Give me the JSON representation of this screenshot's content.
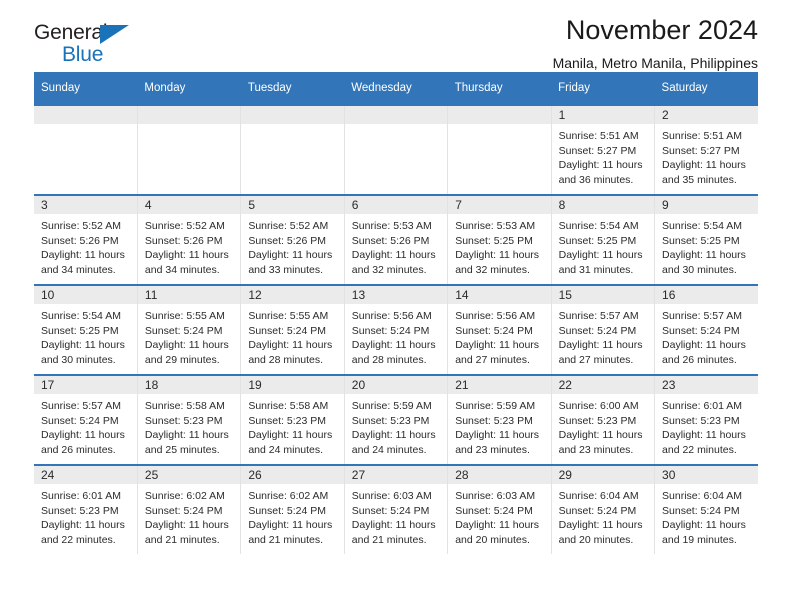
{
  "brand": {
    "name_top": "General",
    "name_bottom": "Blue",
    "triangle_icon": "brand-triangle-icon",
    "accent_color": "#1a72b8"
  },
  "header": {
    "title": "November 2024",
    "subtitle": "Manila, Metro Manila, Philippines"
  },
  "theme": {
    "header_blue": "#3275b8",
    "daynum_band": "#ebebeb",
    "text": "#2b2b2b"
  },
  "calendar": {
    "weekday_headers": [
      "Sunday",
      "Monday",
      "Tuesday",
      "Wednesday",
      "Thursday",
      "Friday",
      "Saturday"
    ],
    "weeks": [
      [
        {
          "day": "",
          "sunrise": "",
          "sunset": "",
          "daylight": "",
          "empty": true
        },
        {
          "day": "",
          "sunrise": "",
          "sunset": "",
          "daylight": "",
          "empty": true
        },
        {
          "day": "",
          "sunrise": "",
          "sunset": "",
          "daylight": "",
          "empty": true
        },
        {
          "day": "",
          "sunrise": "",
          "sunset": "",
          "daylight": "",
          "empty": true
        },
        {
          "day": "",
          "sunrise": "",
          "sunset": "",
          "daylight": "",
          "empty": true
        },
        {
          "day": "1",
          "sunrise": "Sunrise: 5:51 AM",
          "sunset": "Sunset: 5:27 PM",
          "daylight": "Daylight: 11 hours and 36 minutes.",
          "empty": false
        },
        {
          "day": "2",
          "sunrise": "Sunrise: 5:51 AM",
          "sunset": "Sunset: 5:27 PM",
          "daylight": "Daylight: 11 hours and 35 minutes.",
          "empty": false
        }
      ],
      [
        {
          "day": "3",
          "sunrise": "Sunrise: 5:52 AM",
          "sunset": "Sunset: 5:26 PM",
          "daylight": "Daylight: 11 hours and 34 minutes.",
          "empty": false
        },
        {
          "day": "4",
          "sunrise": "Sunrise: 5:52 AM",
          "sunset": "Sunset: 5:26 PM",
          "daylight": "Daylight: 11 hours and 34 minutes.",
          "empty": false
        },
        {
          "day": "5",
          "sunrise": "Sunrise: 5:52 AM",
          "sunset": "Sunset: 5:26 PM",
          "daylight": "Daylight: 11 hours and 33 minutes.",
          "empty": false
        },
        {
          "day": "6",
          "sunrise": "Sunrise: 5:53 AM",
          "sunset": "Sunset: 5:26 PM",
          "daylight": "Daylight: 11 hours and 32 minutes.",
          "empty": false
        },
        {
          "day": "7",
          "sunrise": "Sunrise: 5:53 AM",
          "sunset": "Sunset: 5:25 PM",
          "daylight": "Daylight: 11 hours and 32 minutes.",
          "empty": false
        },
        {
          "day": "8",
          "sunrise": "Sunrise: 5:54 AM",
          "sunset": "Sunset: 5:25 PM",
          "daylight": "Daylight: 11 hours and 31 minutes.",
          "empty": false
        },
        {
          "day": "9",
          "sunrise": "Sunrise: 5:54 AM",
          "sunset": "Sunset: 5:25 PM",
          "daylight": "Daylight: 11 hours and 30 minutes.",
          "empty": false
        }
      ],
      [
        {
          "day": "10",
          "sunrise": "Sunrise: 5:54 AM",
          "sunset": "Sunset: 5:25 PM",
          "daylight": "Daylight: 11 hours and 30 minutes.",
          "empty": false
        },
        {
          "day": "11",
          "sunrise": "Sunrise: 5:55 AM",
          "sunset": "Sunset: 5:24 PM",
          "daylight": "Daylight: 11 hours and 29 minutes.",
          "empty": false
        },
        {
          "day": "12",
          "sunrise": "Sunrise: 5:55 AM",
          "sunset": "Sunset: 5:24 PM",
          "daylight": "Daylight: 11 hours and 28 minutes.",
          "empty": false
        },
        {
          "day": "13",
          "sunrise": "Sunrise: 5:56 AM",
          "sunset": "Sunset: 5:24 PM",
          "daylight": "Daylight: 11 hours and 28 minutes.",
          "empty": false
        },
        {
          "day": "14",
          "sunrise": "Sunrise: 5:56 AM",
          "sunset": "Sunset: 5:24 PM",
          "daylight": "Daylight: 11 hours and 27 minutes.",
          "empty": false
        },
        {
          "day": "15",
          "sunrise": "Sunrise: 5:57 AM",
          "sunset": "Sunset: 5:24 PM",
          "daylight": "Daylight: 11 hours and 27 minutes.",
          "empty": false
        },
        {
          "day": "16",
          "sunrise": "Sunrise: 5:57 AM",
          "sunset": "Sunset: 5:24 PM",
          "daylight": "Daylight: 11 hours and 26 minutes.",
          "empty": false
        }
      ],
      [
        {
          "day": "17",
          "sunrise": "Sunrise: 5:57 AM",
          "sunset": "Sunset: 5:24 PM",
          "daylight": "Daylight: 11 hours and 26 minutes.",
          "empty": false
        },
        {
          "day": "18",
          "sunrise": "Sunrise: 5:58 AM",
          "sunset": "Sunset: 5:23 PM",
          "daylight": "Daylight: 11 hours and 25 minutes.",
          "empty": false
        },
        {
          "day": "19",
          "sunrise": "Sunrise: 5:58 AM",
          "sunset": "Sunset: 5:23 PM",
          "daylight": "Daylight: 11 hours and 24 minutes.",
          "empty": false
        },
        {
          "day": "20",
          "sunrise": "Sunrise: 5:59 AM",
          "sunset": "Sunset: 5:23 PM",
          "daylight": "Daylight: 11 hours and 24 minutes.",
          "empty": false
        },
        {
          "day": "21",
          "sunrise": "Sunrise: 5:59 AM",
          "sunset": "Sunset: 5:23 PM",
          "daylight": "Daylight: 11 hours and 23 minutes.",
          "empty": false
        },
        {
          "day": "22",
          "sunrise": "Sunrise: 6:00 AM",
          "sunset": "Sunset: 5:23 PM",
          "daylight": "Daylight: 11 hours and 23 minutes.",
          "empty": false
        },
        {
          "day": "23",
          "sunrise": "Sunrise: 6:01 AM",
          "sunset": "Sunset: 5:23 PM",
          "daylight": "Daylight: 11 hours and 22 minutes.",
          "empty": false
        }
      ],
      [
        {
          "day": "24",
          "sunrise": "Sunrise: 6:01 AM",
          "sunset": "Sunset: 5:23 PM",
          "daylight": "Daylight: 11 hours and 22 minutes.",
          "empty": false
        },
        {
          "day": "25",
          "sunrise": "Sunrise: 6:02 AM",
          "sunset": "Sunset: 5:24 PM",
          "daylight": "Daylight: 11 hours and 21 minutes.",
          "empty": false
        },
        {
          "day": "26",
          "sunrise": "Sunrise: 6:02 AM",
          "sunset": "Sunset: 5:24 PM",
          "daylight": "Daylight: 11 hours and 21 minutes.",
          "empty": false
        },
        {
          "day": "27",
          "sunrise": "Sunrise: 6:03 AM",
          "sunset": "Sunset: 5:24 PM",
          "daylight": "Daylight: 11 hours and 21 minutes.",
          "empty": false
        },
        {
          "day": "28",
          "sunrise": "Sunrise: 6:03 AM",
          "sunset": "Sunset: 5:24 PM",
          "daylight": "Daylight: 11 hours and 20 minutes.",
          "empty": false
        },
        {
          "day": "29",
          "sunrise": "Sunrise: 6:04 AM",
          "sunset": "Sunset: 5:24 PM",
          "daylight": "Daylight: 11 hours and 20 minutes.",
          "empty": false
        },
        {
          "day": "30",
          "sunrise": "Sunrise: 6:04 AM",
          "sunset": "Sunset: 5:24 PM",
          "daylight": "Daylight: 11 hours and 19 minutes.",
          "empty": false
        }
      ]
    ]
  }
}
